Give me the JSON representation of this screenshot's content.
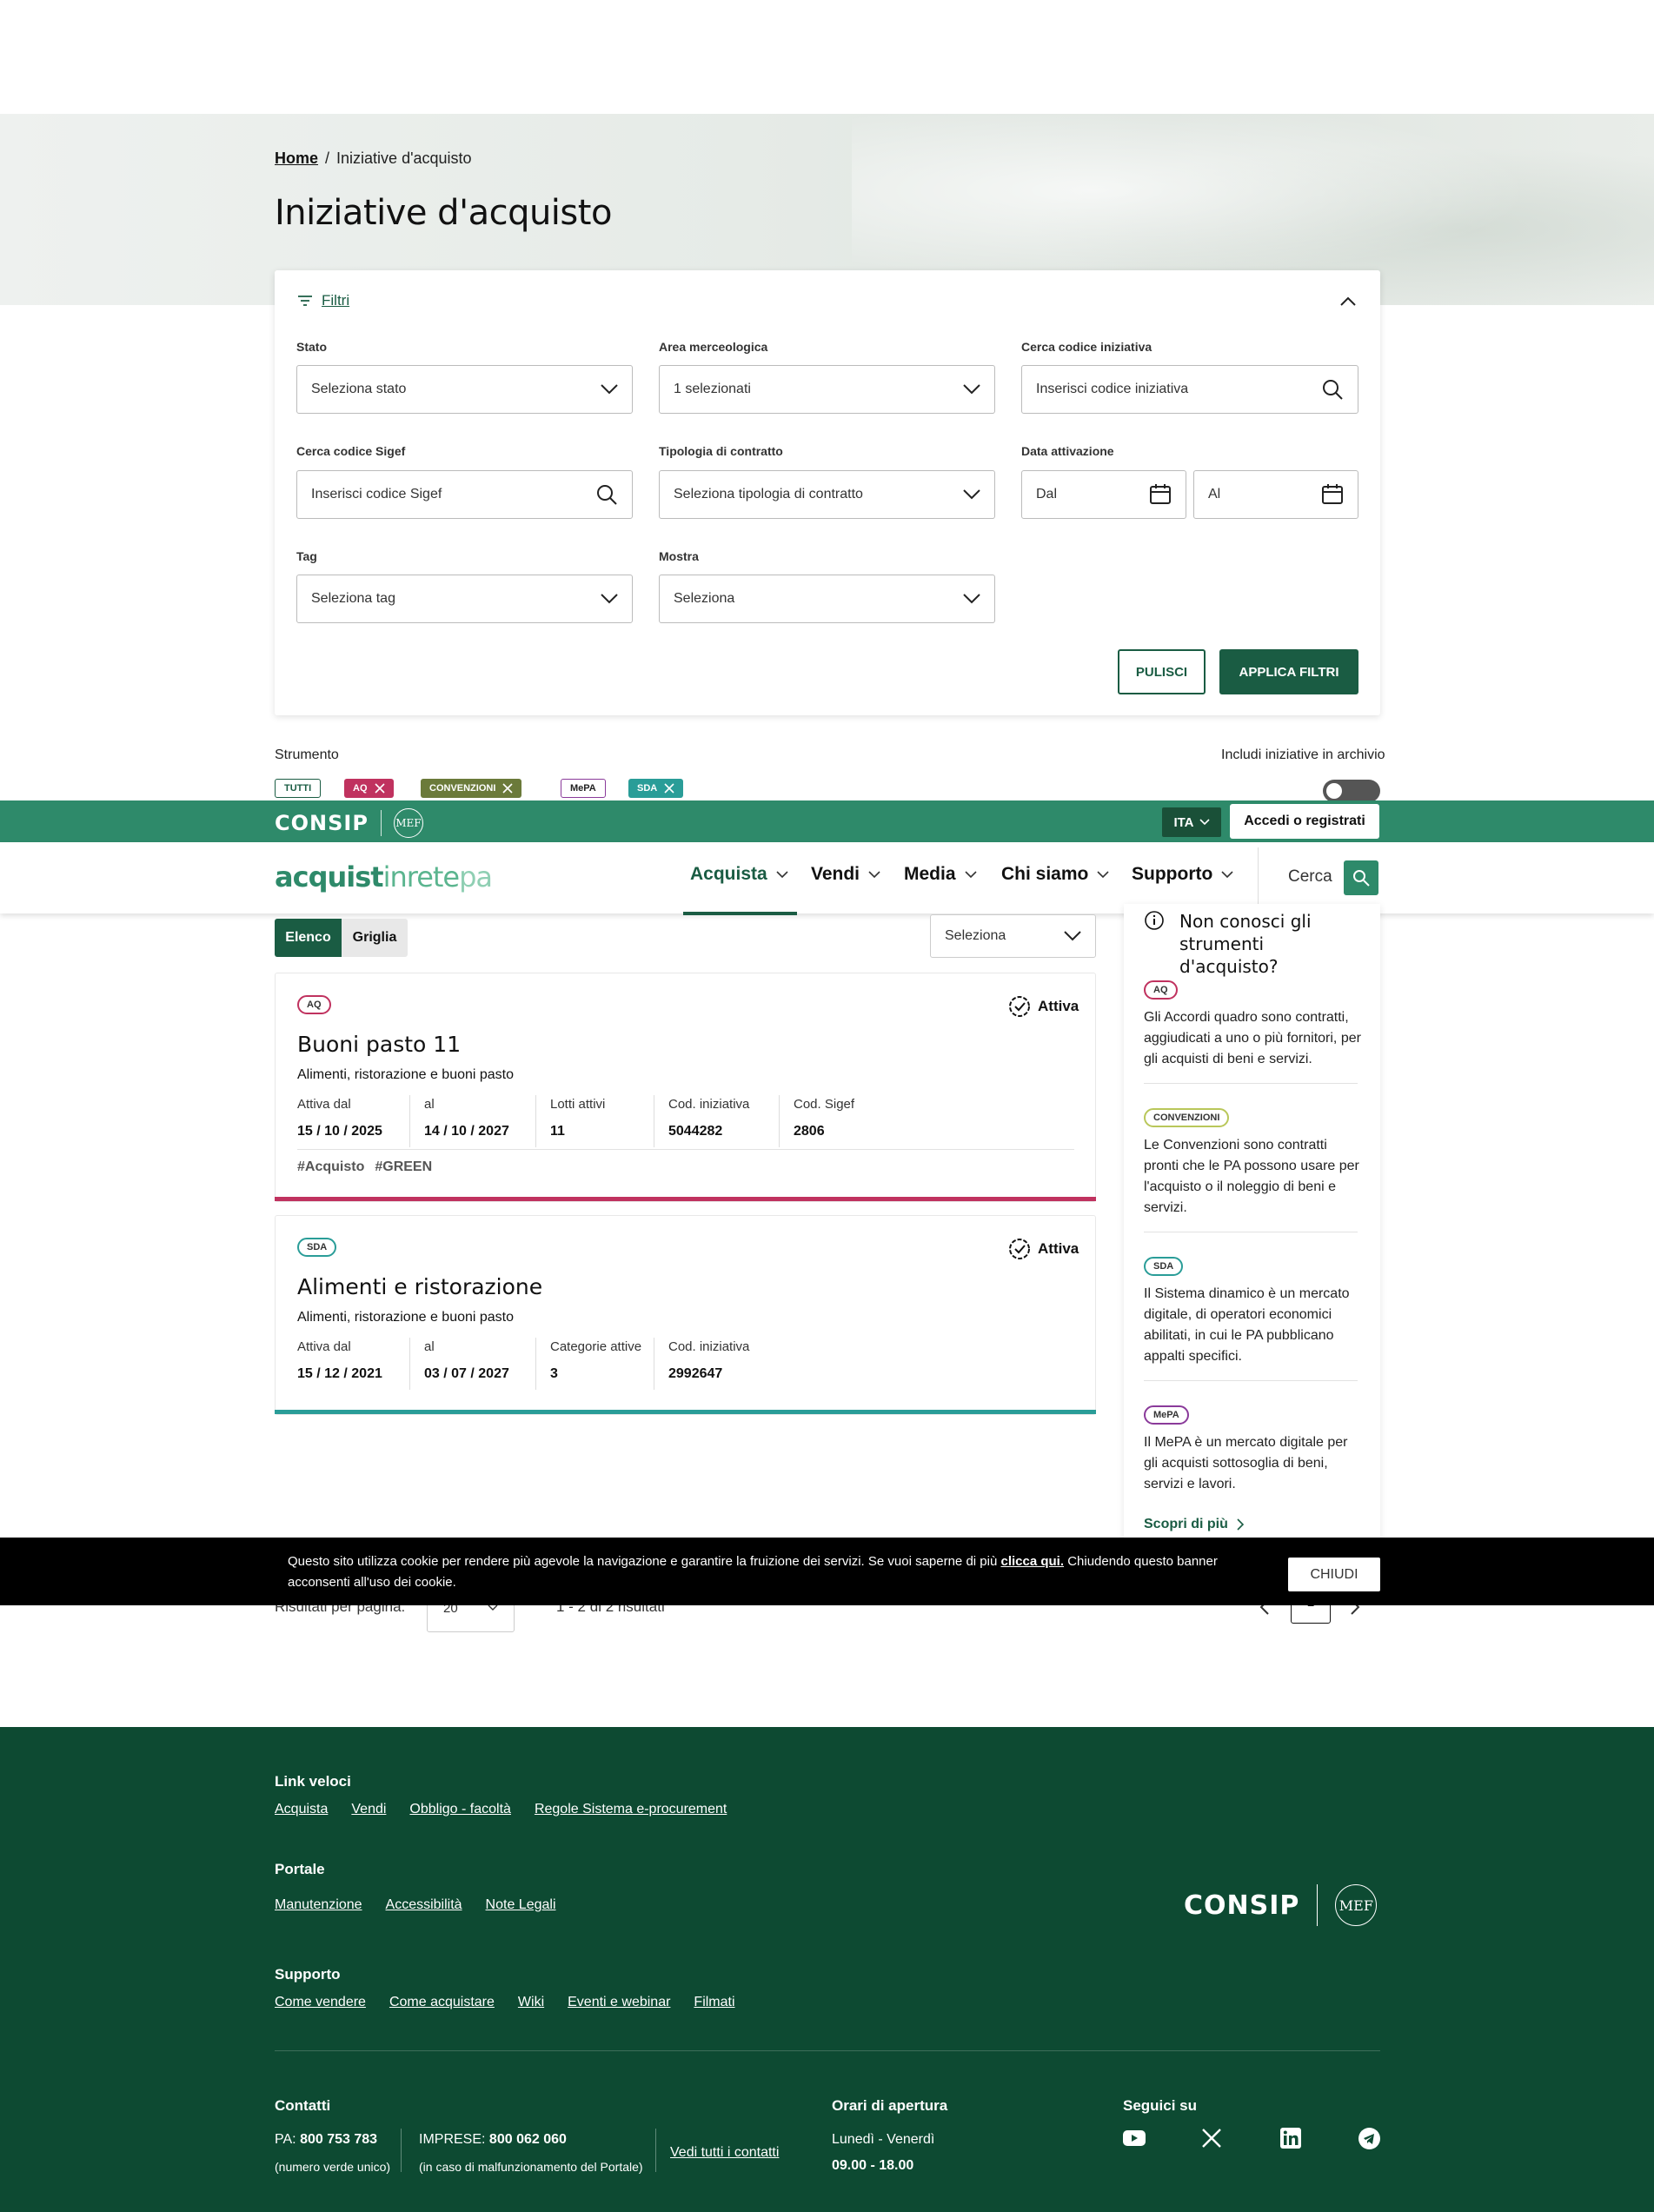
{
  "breadcrumb": {
    "home": "Home",
    "current": "Iniziative d'acquisto"
  },
  "page_title": "Iniziative d'acquisto",
  "filters": {
    "toggle_label": "Filtri",
    "stato": {
      "label": "Stato",
      "value": "Seleziona stato"
    },
    "area": {
      "label": "Area merceologica",
      "value": "1 selezionati"
    },
    "codice": {
      "label": "Cerca codice iniziativa",
      "placeholder": "Inserisci codice iniziativa"
    },
    "sigef": {
      "label": "Cerca codice Sigef",
      "placeholder": "Inserisci codice Sigef"
    },
    "tipologia": {
      "label": "Tipologia di contratto",
      "value": "Seleziona tipologia di contratto"
    },
    "data": {
      "label": "Data attivazione",
      "dal": "Dal",
      "al": "Al"
    },
    "tag": {
      "label": "Tag",
      "value": "Seleziona tag"
    },
    "mostra": {
      "label": "Mostra",
      "value": "Seleziona"
    },
    "clear_label": "PULISCI",
    "apply_label": "APPLICA FILTRI"
  },
  "strumento": {
    "label": "Strumento",
    "chips": {
      "tutti": "TUTTI",
      "aq": "AQ",
      "convenzioni": "CONVENZIONI",
      "mepa": "MePA",
      "sda": "SDA"
    },
    "archive_label": "Includi iniziative in archivio",
    "archive_on": false
  },
  "topbar": {
    "consip": "CONSIP",
    "mef": "MEF",
    "lang": "ITA",
    "login": "Accedi o registrati"
  },
  "nav": {
    "logo": {
      "a": "acquist",
      "b": "inrete",
      "c": "pa"
    },
    "items": [
      "Acquista",
      "Vendi",
      "Media",
      "Chi siamo",
      "Supporto"
    ],
    "search_label": "Cerca"
  },
  "view": {
    "list": "Elenco",
    "grid": "Griglia",
    "select": "Seleziona"
  },
  "initiatives": [
    {
      "badge": "AQ",
      "status": "Attiva",
      "title": "Buoni pasto 11",
      "subtitle": "Alimenti, ristorazione e buoni pasto",
      "meta": [
        {
          "label": "Attiva dal",
          "value": "15 / 10 / 2025"
        },
        {
          "label": "al",
          "value": "14 / 10 / 2027"
        },
        {
          "label": "Lotti attivi",
          "value": "11"
        },
        {
          "label": "Cod. iniziativa",
          "value": "5044282"
        },
        {
          "label": "Cod. Sigef",
          "value": "2806"
        }
      ],
      "tags": [
        "#Acquisto",
        "#GREEN"
      ],
      "accent": "#c0325f"
    },
    {
      "badge": "SDA",
      "status": "Attiva",
      "title": "Alimenti e ristorazione",
      "subtitle": "Alimenti, ristorazione e buoni pasto",
      "meta": [
        {
          "label": "Attiva dal",
          "value": "15 / 12 / 2021"
        },
        {
          "label": "al",
          "value": "03 / 07 / 2027"
        },
        {
          "label": "Categorie attive",
          "value": "3"
        },
        {
          "label": "Cod. iniziativa",
          "value": "2992647"
        }
      ],
      "accent": "#2a9d98"
    }
  ],
  "sidebar": {
    "title": "Non conosci gli strumenti d'acquisto?",
    "items": [
      {
        "badge": "AQ",
        "text": "Gli Accordi quadro sono contratti, aggiudicati a uno o più fornitori, per gli acquisti di beni e servizi."
      },
      {
        "badge": "CONVENZIONI",
        "text": "Le Convenzioni sono contratti pronti che le PA possono usare per l'acquisto o il noleggio di beni e servizi."
      },
      {
        "badge": "SDA",
        "text": "Il Sistema dinamico è un mercato digitale, di operatori economici abilitati, in cui le PA pubblicano appalti specifici."
      },
      {
        "badge": "MePA",
        "text": "Il MePA è un mercato digitale per gli acquisti sottosoglia di beni, servizi e lavori."
      }
    ],
    "more": "Scopri di più"
  },
  "pagination": {
    "per_page_label": "Risultati per pagina:",
    "per_page": "20",
    "range": "1 - 2 di 2 risultati",
    "page": "1"
  },
  "cookie": {
    "text": "Questo sito utilizza cookie per rendere più agevole la navigazione e garantire la fruizione dei servizi. Se vuoi saperne di più",
    "link": "clicca qui.",
    "text2": "Chiudendo questo banner acconsenti all'uso dei cookie.",
    "close": "CHIUDI"
  },
  "footer": {
    "quick": {
      "title": "Link veloci",
      "links": [
        "Acquista",
        "Vendi",
        "Obbligo - facoltà",
        "Regole Sistema e-procurement"
      ]
    },
    "portale": {
      "title": "Portale",
      "links": [
        "Manutenzione",
        "Accessibilità",
        "Note Legali"
      ]
    },
    "supporto": {
      "title": "Supporto",
      "links": [
        "Come vendere",
        "Come acquistare",
        "Wiki",
        "Eventi e webinar",
        "Filmati"
      ]
    },
    "contatti": {
      "title": "Contatti",
      "pa_label": "PA:",
      "pa_number": "800 753 783",
      "pa_note": "(numero verde unico)",
      "imprese_label": "IMPRESE:",
      "imprese_number": "800 062 060",
      "imprese_note": "(in caso di malfunzionamento del Portale)",
      "all": "Vedi tutti i contatti"
    },
    "orari": {
      "title": "Orari di apertura",
      "days": "Lunedì - Venerdì",
      "hours": "09.00 - 18.00"
    },
    "social": {
      "title": "Seguici su"
    },
    "consip": "CONSIP",
    "mef": "MEF"
  },
  "colors": {
    "primary": "#1a5c43",
    "topbar": "#2e8a6a",
    "footer": "#0d4a32",
    "aq": "#c0325f",
    "sda": "#2a9d98",
    "conv": "#6b7a3a",
    "mepa": "#8a3a9a"
  }
}
